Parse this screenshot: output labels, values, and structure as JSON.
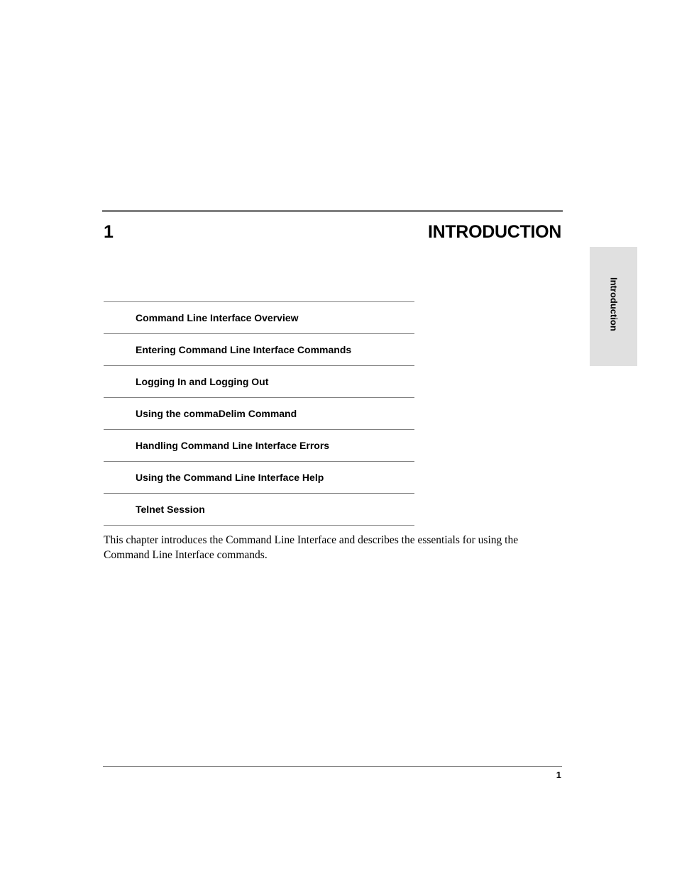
{
  "chapter": {
    "number": "1",
    "title": "INTRODUCTION"
  },
  "side_tab": {
    "label": "Introduction"
  },
  "toc": {
    "items": [
      {
        "label": "Command Line Interface Overview"
      },
      {
        "label": "Entering Command Line Interface Commands"
      },
      {
        "label": "Logging In and Logging Out"
      },
      {
        "label": "Using the commaDelim Command"
      },
      {
        "label": "Handling Command Line Interface Errors"
      },
      {
        "label": "Using the Command Line Interface Help"
      },
      {
        "label": "Telnet Session"
      }
    ]
  },
  "body": {
    "intro_paragraph": "This chapter introduces the Command Line Interface and describes the essentials for using the Command Line Interface commands."
  },
  "footer": {
    "page_number": "1"
  },
  "colors": {
    "rule": "#808080",
    "side_tab_background": "#e0e0e0",
    "text": "#000000"
  }
}
